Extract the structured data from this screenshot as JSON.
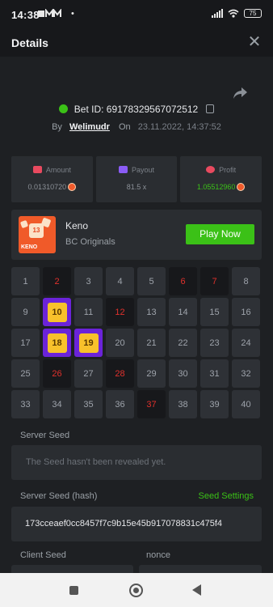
{
  "statusbar": {
    "time": "14:38",
    "extra": "•",
    "battery": "75"
  },
  "header": {
    "title": "Details"
  },
  "bet": {
    "id_label": "Bet ID: 69178329567072512",
    "by_label": "By",
    "user": "Welimudr",
    "on_label": "On",
    "date": "23.11.2022, 14:37:52"
  },
  "stats": [
    {
      "label": "Amount",
      "value": "0.01310720",
      "color": "#e84a5f"
    },
    {
      "label": "Payout",
      "value": "81.5 x",
      "color": "#8b5cf6"
    },
    {
      "label": "Profit",
      "value": "1.05512960",
      "color": "#e84a5f"
    }
  ],
  "game": {
    "name": "Keno",
    "provider": "BC Originals",
    "thumb_label": "KENO",
    "thumb_number": "13",
    "play_label": "Play Now"
  },
  "grid": {
    "numbers": [
      "1",
      "2",
      "3",
      "4",
      "5",
      "6",
      "7",
      "8",
      "9",
      "10",
      "11",
      "12",
      "13",
      "14",
      "15",
      "16",
      "17",
      "18",
      "19",
      "20",
      "21",
      "22",
      "23",
      "24",
      "25",
      "26",
      "27",
      "28",
      "29",
      "30",
      "31",
      "32",
      "33",
      "34",
      "35",
      "36",
      "37",
      "38",
      "39",
      "40"
    ],
    "drawn": [
      "2",
      "6",
      "7",
      "12",
      "26",
      "28",
      "37"
    ],
    "selected_hits": [
      "10",
      "18",
      "19"
    ]
  },
  "seeds": {
    "server_label": "Server Seed",
    "server_value": "The Seed hasn't been revealed yet.",
    "hash_label": "Server Seed (hash)",
    "settings_label": "Seed Settings",
    "hash_value": "173cceaef0cc8457f7c9b15e45b917078831c475f4",
    "client_label": "Client Seed",
    "nonce_label": "nonce"
  }
}
